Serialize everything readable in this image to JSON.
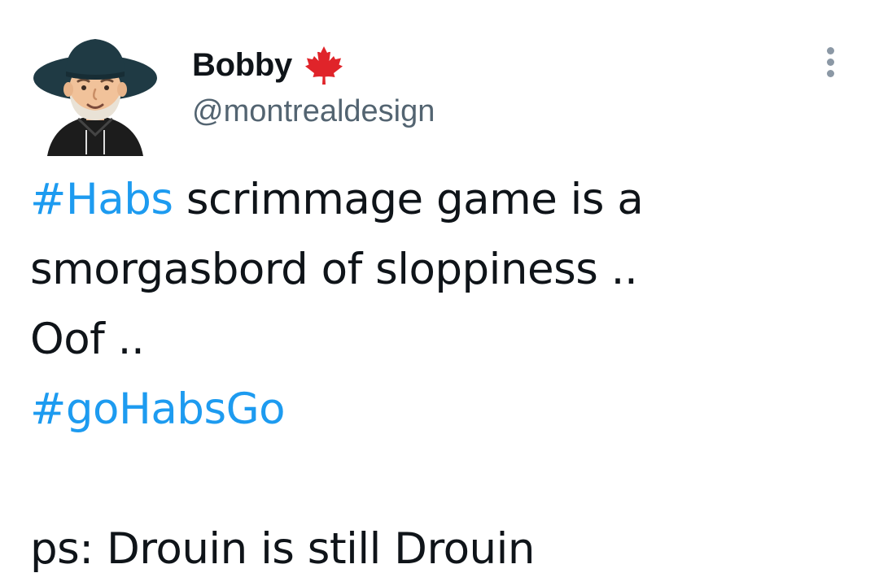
{
  "tweet": {
    "author": {
      "display_name": "Bobby",
      "flag_icon": "maple-leaf-icon",
      "flag_color": "#e0242a",
      "handle": "@montrealdesign",
      "avatar": "avatar-illustration"
    },
    "more_icon": "more-options-icon",
    "text": {
      "line1_hashtag": "#Habs",
      "line1_rest": " scrimmage game is a",
      "line2": "smorgasbord of sloppiness ..",
      "line3": "Oof ..",
      "line4_hashtag": "#goHabsGo",
      "line6": "ps: Drouin is still Drouin"
    },
    "colors": {
      "hashtag": "#1d9bf0",
      "text": "#0f1419",
      "handle": "#536471"
    }
  }
}
